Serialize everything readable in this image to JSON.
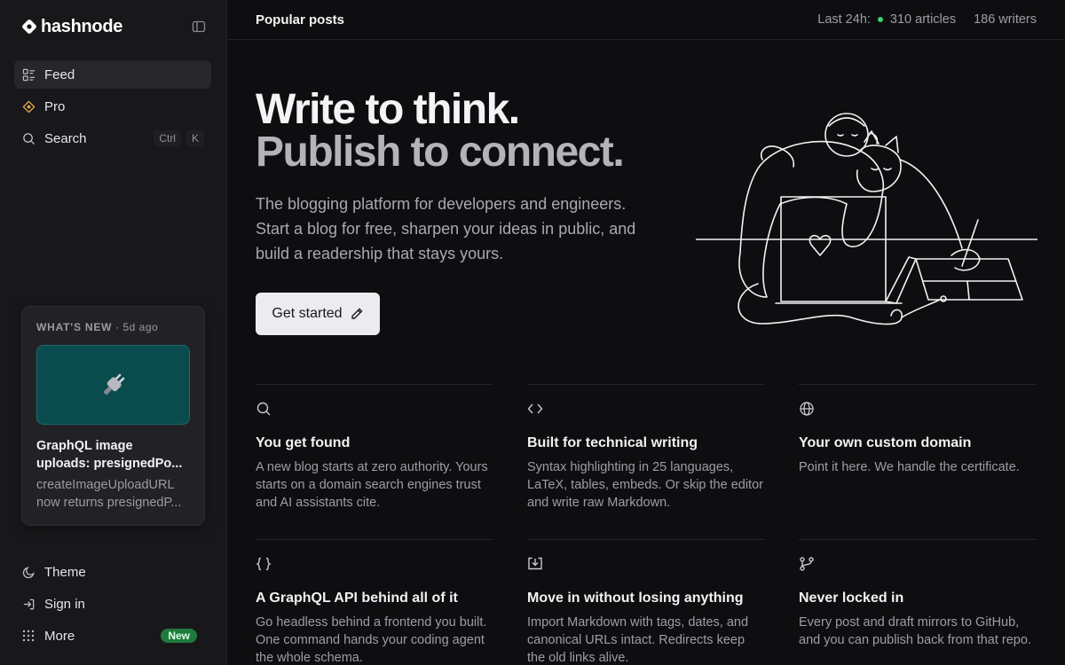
{
  "brand": {
    "name": "hashnode"
  },
  "sidebar": {
    "nav": [
      {
        "label": "Feed",
        "icon": "feed-icon",
        "active": true
      },
      {
        "label": "Pro",
        "icon": "pro-icon"
      },
      {
        "label": "Search",
        "icon": "search-icon",
        "shortcut": [
          "Ctrl",
          "K"
        ]
      }
    ],
    "whats_new": {
      "label": "WHAT'S NEW",
      "age": "· 5d ago",
      "thumb_icon": "plug-icon",
      "title_lines": [
        "GraphQL image",
        "uploads: presignedPo..."
      ],
      "desc_lines": [
        "createImageUploadURL",
        "now returns presignedP..."
      ]
    },
    "bottom": [
      {
        "label": "Theme",
        "icon": "moon-icon"
      },
      {
        "label": "Sign in",
        "icon": "sign-in-icon"
      },
      {
        "label": "More",
        "icon": "grid-dots-icon",
        "badge": "New"
      }
    ]
  },
  "topbar": {
    "title": "Popular posts",
    "stats_label": "Last 24h:",
    "articles": "310 articles",
    "writers": "186 writers",
    "live_color": "#3ccf6b"
  },
  "hero": {
    "line1": "Write to think.",
    "line2": "Publish to connect.",
    "description": "The blogging platform for developers and engineers. Start a blog for free, sharpen your ideas in public, and build a readership that stays yours.",
    "cta": "Get started"
  },
  "features": [
    {
      "icon": "search-icon",
      "title": "You get found",
      "text": "A new blog starts at zero authority. Yours starts on a domain search engines trust and AI assistants cite."
    },
    {
      "icon": "code-icon",
      "title": "Built for technical writing",
      "text": "Syntax highlighting in 25 languages, LaTeX, tables, embeds. Or skip the editor and write raw Markdown."
    },
    {
      "icon": "globe-icon",
      "title": "Your own custom domain",
      "text": "Point it here. We handle the certificate."
    },
    {
      "icon": "braces-icon",
      "title": "A GraphQL API behind all of it",
      "text": "Go headless behind a frontend you built. One command hands your coding agent the whole schema."
    },
    {
      "icon": "import-icon",
      "title": "Move in without losing anything",
      "text": "Import Markdown with tags, dates, and canonical URLs intact. Redirects keep the old links alive."
    },
    {
      "icon": "git-branch-icon",
      "title": "Never locked in",
      "text": "Every post and draft mirrors to GitHub, and you can publish back from that repo."
    }
  ]
}
